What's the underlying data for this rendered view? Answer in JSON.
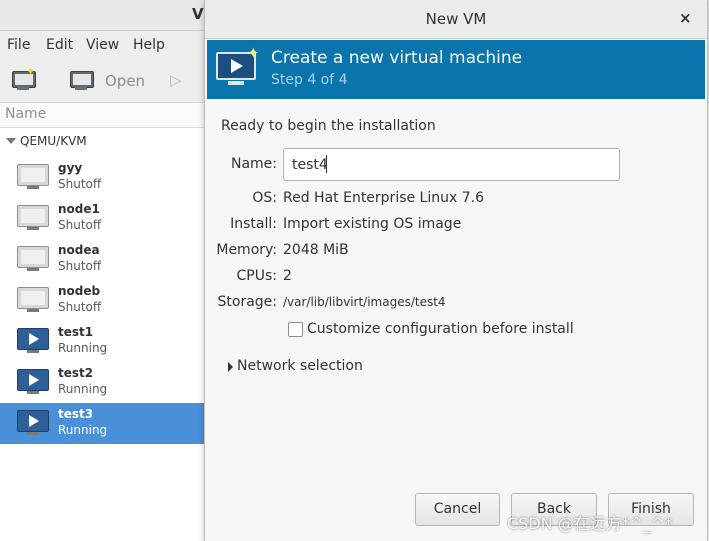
{
  "main_window": {
    "title": "Vi",
    "menu": [
      "File",
      "Edit",
      "View",
      "Help"
    ],
    "toolbar": {
      "open_label": "Open"
    },
    "list_header": "Name",
    "group": "QEMU/KVM",
    "vms": [
      {
        "name": "gyy",
        "status": "Shutoff",
        "running": false,
        "selected": false
      },
      {
        "name": "node1",
        "status": "Shutoff",
        "running": false,
        "selected": false
      },
      {
        "name": "nodea",
        "status": "Shutoff",
        "running": false,
        "selected": false
      },
      {
        "name": "nodeb",
        "status": "Shutoff",
        "running": false,
        "selected": false
      },
      {
        "name": "test1",
        "status": "Running",
        "running": true,
        "selected": false
      },
      {
        "name": "test2",
        "status": "Running",
        "running": true,
        "selected": false
      },
      {
        "name": "test3",
        "status": "Running",
        "running": true,
        "selected": true
      }
    ]
  },
  "dialog": {
    "title": "New VM",
    "close_glyph": "×",
    "banner": {
      "title": "Create a new virtual machine",
      "step": "Step 4 of 4"
    },
    "ready_text": "Ready to begin the installation",
    "fields": {
      "name_label": "Name:",
      "name_value": "test4",
      "os_label": "OS:",
      "os_value": "Red Hat Enterprise Linux 7.6",
      "install_label": "Install:",
      "install_value": "Import existing OS image",
      "memory_label": "Memory:",
      "memory_value": "2048 MiB",
      "cpus_label": "CPUs:",
      "cpus_value": "2",
      "storage_label": "Storage:",
      "storage_value": "/var/lib/libvirt/images/test4"
    },
    "customize_label": "Customize configuration before install",
    "customize_checked": false,
    "network_label": "Network selection",
    "buttons": {
      "cancel": "Cancel",
      "back": "Back",
      "finish": "Finish"
    }
  },
  "watermark": "CSDN @在远方*^_^*",
  "colors": {
    "banner": "#0a74ad",
    "selection": "#4a90d9",
    "step_text": "#a9d0ec"
  }
}
